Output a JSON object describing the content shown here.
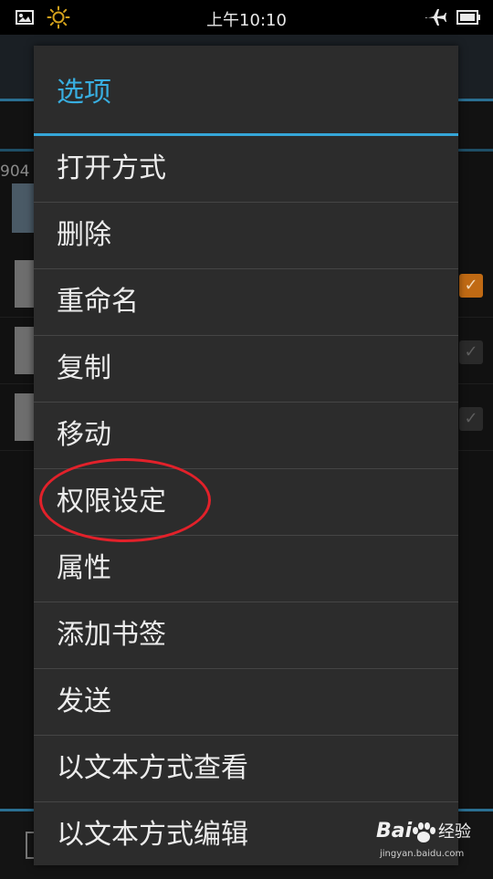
{
  "status_bar": {
    "time": "上午10:10",
    "icons": [
      "image-icon",
      "sun-icon",
      "airplane-icon",
      "battery-icon"
    ]
  },
  "background_app": {
    "path_text": "904",
    "rows": [
      {
        "checked": true
      },
      {
        "checked": false
      },
      {
        "checked": false
      }
    ],
    "accent_color": "#2a6f92"
  },
  "dialog": {
    "title": "选项",
    "title_color": "#38aee0",
    "items": [
      "打开方式",
      "删除",
      "重命名",
      "复制",
      "移动",
      "权限设定",
      "属性",
      "添加书签",
      "发送",
      "以文本方式查看",
      "以文本方式编辑"
    ]
  },
  "annotation": {
    "highlighted_item": "权限设定",
    "color": "#e2212a"
  },
  "watermark": {
    "brand": "Bai",
    "suffix": "经验",
    "url": "jingyan.baidu.com"
  }
}
